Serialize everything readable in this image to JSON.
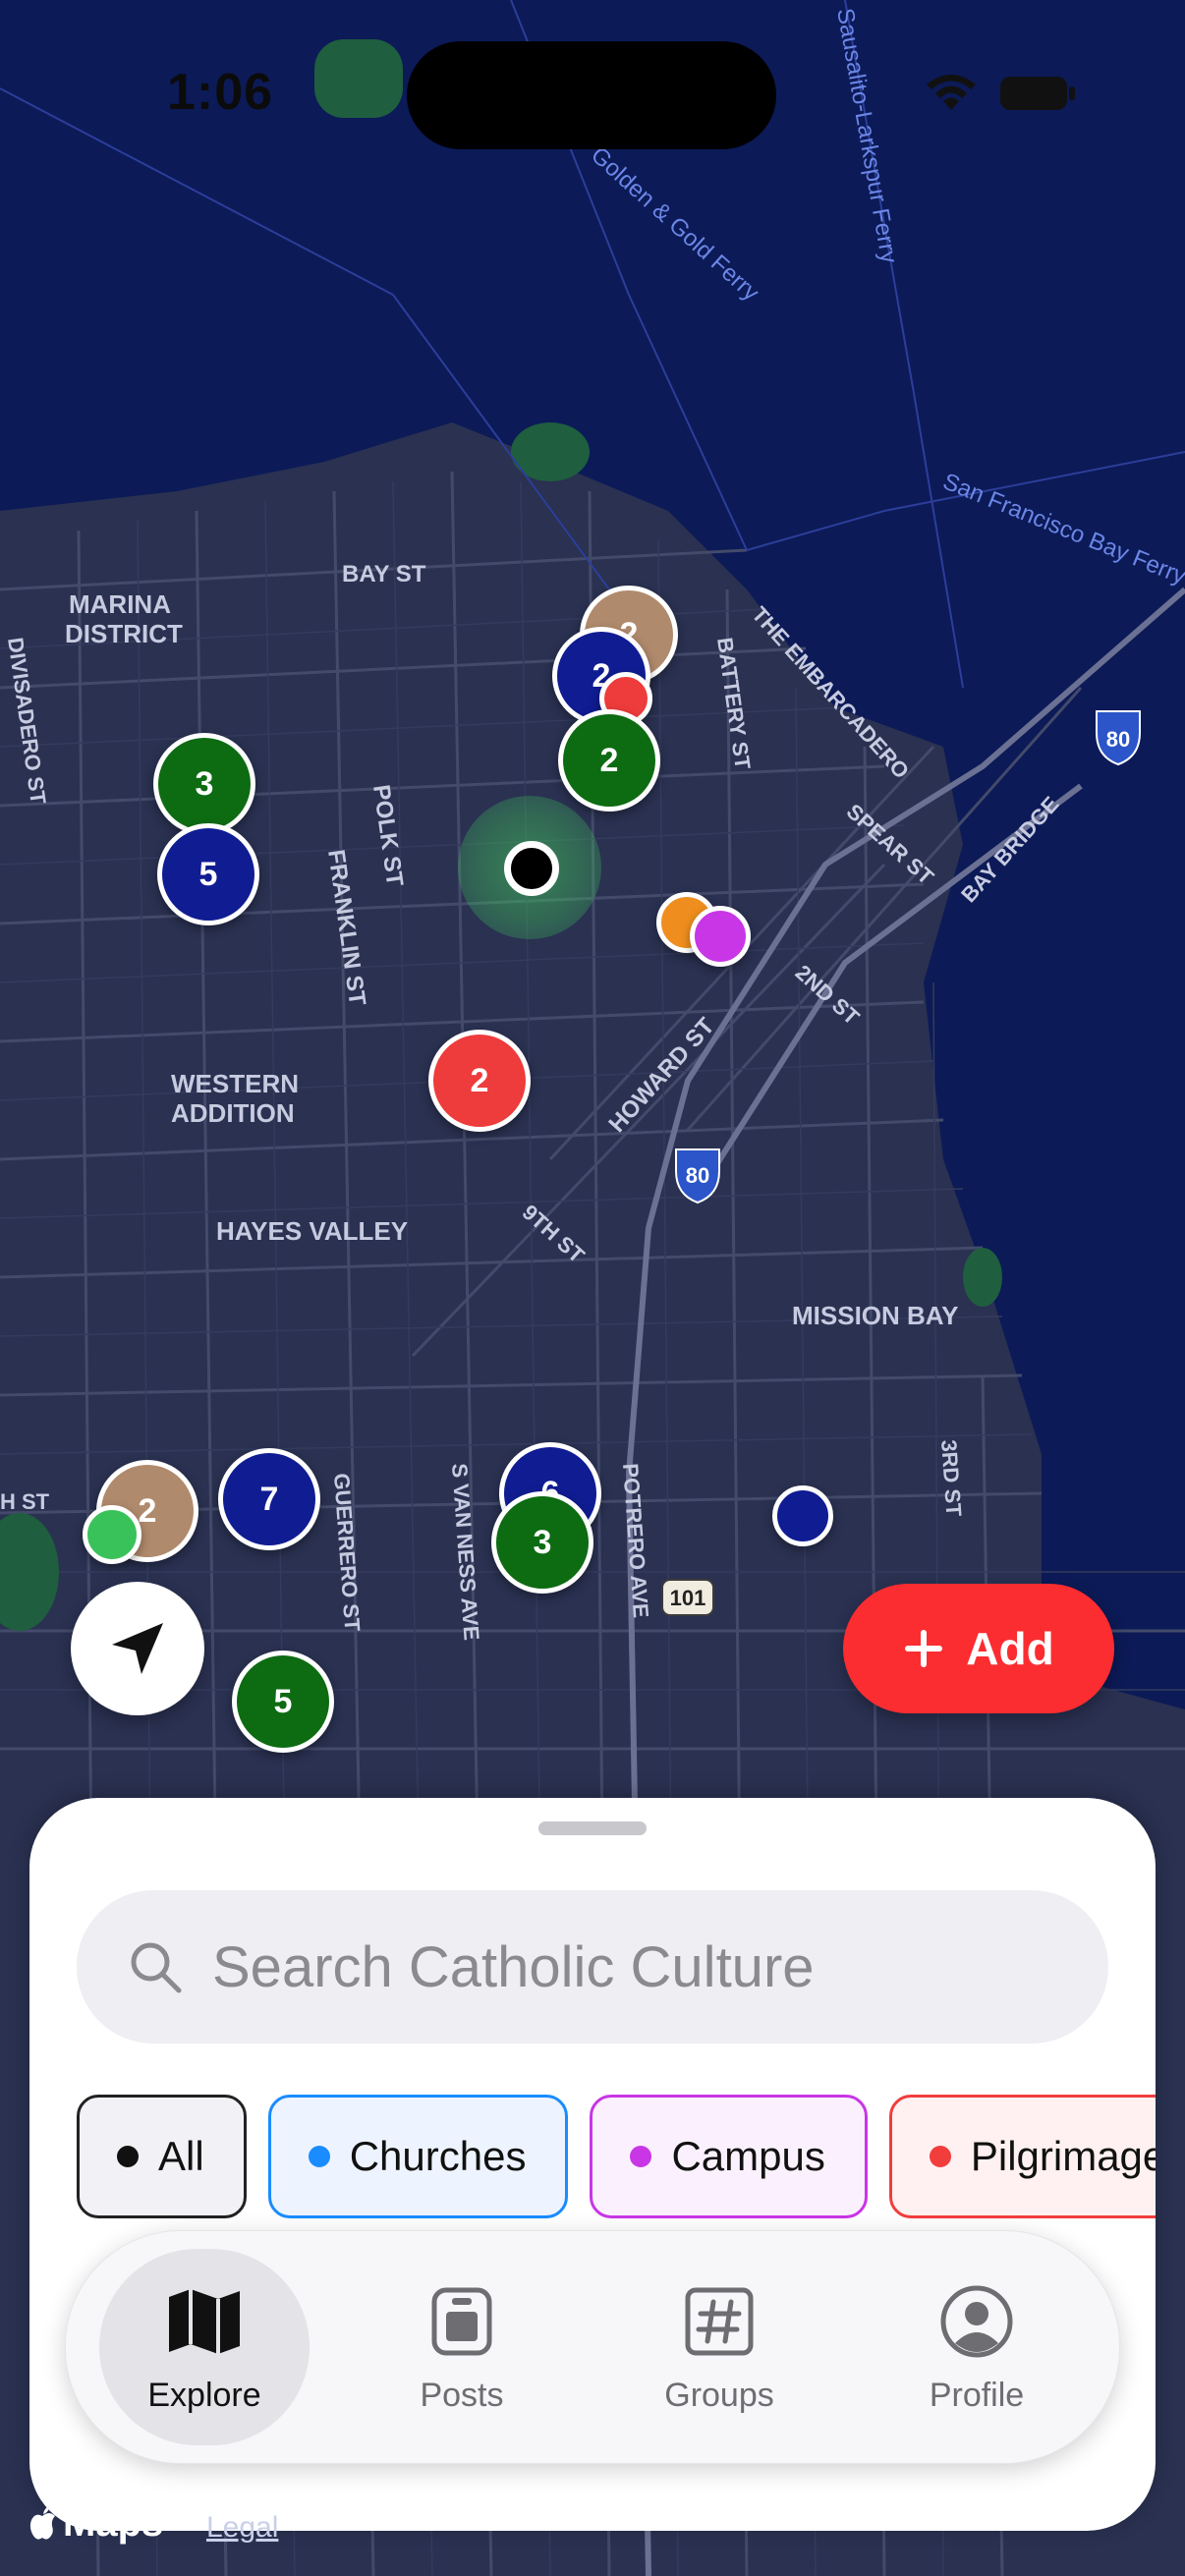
{
  "status_bar": {
    "time": "1:06"
  },
  "map": {
    "district_labels": [
      "MARINA",
      "DISTRICT",
      "WESTERN",
      "ADDITION",
      "HAYES VALLEY",
      "MISSION BAY"
    ],
    "street_labels": [
      "BAY ST",
      "POLK ST",
      "FRANKLIN ST",
      "DIVISADERO ST",
      "HOWARD ST",
      "9TH ST",
      "2ND ST",
      "SPEAR ST",
      "BATTERY ST",
      "THE EMBARCADERO",
      "BAY BRIDGE",
      "GUERRERO ST",
      "S VAN NESS AVE",
      "POTRERO AVE",
      "3RD ST",
      "H ST"
    ],
    "water_labels": [
      "San Francisco Bay Ferry",
      "Golden & Gold Ferry",
      "Sausalito-Larkspur Ferry"
    ],
    "highway_shields": [
      "80",
      "80",
      "101"
    ],
    "markers": [
      {
        "label": "2",
        "category": "tan"
      },
      {
        "label": "2",
        "category": "navy"
      },
      {
        "label": "",
        "category": "red"
      },
      {
        "label": "2",
        "category": "green"
      },
      {
        "label": "3",
        "category": "green"
      },
      {
        "label": "5",
        "category": "navy"
      },
      {
        "label": "",
        "category": "orange"
      },
      {
        "label": "",
        "category": "purple"
      },
      {
        "label": "2",
        "category": "red"
      },
      {
        "label": "2",
        "category": "tan"
      },
      {
        "label": "",
        "category": "light-green"
      },
      {
        "label": "7",
        "category": "navy"
      },
      {
        "label": "6",
        "category": "navy"
      },
      {
        "label": "3",
        "category": "green"
      },
      {
        "label": "",
        "category": "navy"
      },
      {
        "label": "5",
        "category": "green"
      }
    ]
  },
  "buttons": {
    "add_label": "Add",
    "locate_icon": "location-arrow-icon"
  },
  "sheet": {
    "search_placeholder": "Search Catholic Culture",
    "chips": [
      {
        "label": "All",
        "dot_color": "#111111",
        "border_color": "#222222",
        "bg": "#f2f2f6"
      },
      {
        "label": "Churches",
        "dot_color": "#1a8cff",
        "border_color": "#1a8cff",
        "bg": "#eef4ff"
      },
      {
        "label": "Campus",
        "dot_color": "#c836e6",
        "border_color": "#c836e6",
        "bg": "#fbf1fe"
      },
      {
        "label": "Pilgrimages",
        "dot_color": "#f23d3d",
        "border_color": "#f23d3d",
        "bg": "#fff1f1"
      }
    ]
  },
  "tabbar": {
    "tabs": [
      {
        "label": "Explore",
        "icon": "map-icon",
        "active": true
      },
      {
        "label": "Posts",
        "icon": "posts-icon",
        "active": false
      },
      {
        "label": "Groups",
        "icon": "hashtag-icon",
        "active": false
      },
      {
        "label": "Profile",
        "icon": "person-circle-icon",
        "active": false
      }
    ]
  },
  "footer": {
    "maps_label": "Maps",
    "legal_label": "Legal"
  },
  "colors": {
    "map_water": "#0c1a57",
    "map_land": "#2a3151",
    "accent_red": "#fb2d31"
  }
}
